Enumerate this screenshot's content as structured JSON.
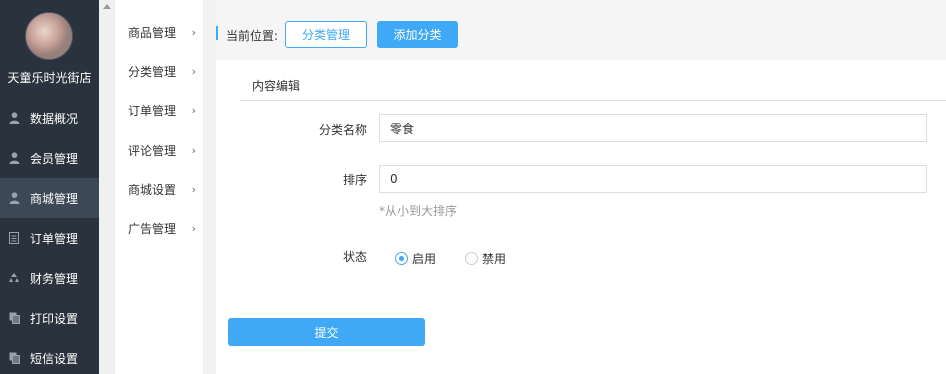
{
  "sidebar": {
    "shop_name": "天童乐时光街店",
    "items": [
      {
        "label": "数据概况",
        "icon": "user-icon"
      },
      {
        "label": "会员管理",
        "icon": "user-icon"
      },
      {
        "label": "商城管理",
        "icon": "user-icon"
      },
      {
        "label": "订单管理",
        "icon": "document-icon"
      },
      {
        "label": "财务管理",
        "icon": "recycle-icon"
      },
      {
        "label": "打印设置",
        "icon": "copy-icon"
      },
      {
        "label": "短信设置",
        "icon": "copy-icon"
      }
    ]
  },
  "submenu": {
    "items": [
      {
        "label": "商品管理"
      },
      {
        "label": "分类管理"
      },
      {
        "label": "订单管理"
      },
      {
        "label": "评论管理"
      },
      {
        "label": "商城设置"
      },
      {
        "label": "广告管理"
      }
    ]
  },
  "breadcrumb": {
    "label": "当前位置:",
    "category_button": "分类管理",
    "add_button": "添加分类"
  },
  "form": {
    "section_title": "内容编辑",
    "name_label": "分类名称",
    "name_value": "零食",
    "sort_label": "排序",
    "sort_value": "0",
    "sort_hint": "*从小到大排序",
    "status_label": "状态",
    "status_enabled": "启用",
    "status_disabled": "禁用",
    "submit_label": "提交"
  },
  "colors": {
    "accent": "#3fa9f5",
    "sidebar_bg": "#2a333d",
    "sidebar_active": "#3c4856"
  }
}
